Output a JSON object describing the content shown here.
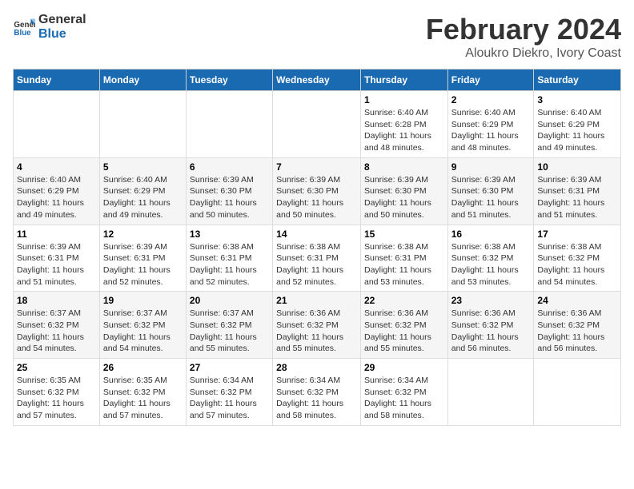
{
  "logo": {
    "text_general": "General",
    "text_blue": "Blue"
  },
  "header": {
    "title": "February 2024",
    "subtitle": "Aloukro Diekro, Ivory Coast"
  },
  "days_of_week": [
    "Sunday",
    "Monday",
    "Tuesday",
    "Wednesday",
    "Thursday",
    "Friday",
    "Saturday"
  ],
  "weeks": [
    [
      {
        "day": "",
        "detail": ""
      },
      {
        "day": "",
        "detail": ""
      },
      {
        "day": "",
        "detail": ""
      },
      {
        "day": "",
        "detail": ""
      },
      {
        "day": "1",
        "detail": "Sunrise: 6:40 AM\nSunset: 6:28 PM\nDaylight: 11 hours\nand 48 minutes."
      },
      {
        "day": "2",
        "detail": "Sunrise: 6:40 AM\nSunset: 6:29 PM\nDaylight: 11 hours\nand 48 minutes."
      },
      {
        "day": "3",
        "detail": "Sunrise: 6:40 AM\nSunset: 6:29 PM\nDaylight: 11 hours\nand 49 minutes."
      }
    ],
    [
      {
        "day": "4",
        "detail": "Sunrise: 6:40 AM\nSunset: 6:29 PM\nDaylight: 11 hours\nand 49 minutes."
      },
      {
        "day": "5",
        "detail": "Sunrise: 6:40 AM\nSunset: 6:29 PM\nDaylight: 11 hours\nand 49 minutes."
      },
      {
        "day": "6",
        "detail": "Sunrise: 6:39 AM\nSunset: 6:30 PM\nDaylight: 11 hours\nand 50 minutes."
      },
      {
        "day": "7",
        "detail": "Sunrise: 6:39 AM\nSunset: 6:30 PM\nDaylight: 11 hours\nand 50 minutes."
      },
      {
        "day": "8",
        "detail": "Sunrise: 6:39 AM\nSunset: 6:30 PM\nDaylight: 11 hours\nand 50 minutes."
      },
      {
        "day": "9",
        "detail": "Sunrise: 6:39 AM\nSunset: 6:30 PM\nDaylight: 11 hours\nand 51 minutes."
      },
      {
        "day": "10",
        "detail": "Sunrise: 6:39 AM\nSunset: 6:31 PM\nDaylight: 11 hours\nand 51 minutes."
      }
    ],
    [
      {
        "day": "11",
        "detail": "Sunrise: 6:39 AM\nSunset: 6:31 PM\nDaylight: 11 hours\nand 51 minutes."
      },
      {
        "day": "12",
        "detail": "Sunrise: 6:39 AM\nSunset: 6:31 PM\nDaylight: 11 hours\nand 52 minutes."
      },
      {
        "day": "13",
        "detail": "Sunrise: 6:38 AM\nSunset: 6:31 PM\nDaylight: 11 hours\nand 52 minutes."
      },
      {
        "day": "14",
        "detail": "Sunrise: 6:38 AM\nSunset: 6:31 PM\nDaylight: 11 hours\nand 52 minutes."
      },
      {
        "day": "15",
        "detail": "Sunrise: 6:38 AM\nSunset: 6:31 PM\nDaylight: 11 hours\nand 53 minutes."
      },
      {
        "day": "16",
        "detail": "Sunrise: 6:38 AM\nSunset: 6:32 PM\nDaylight: 11 hours\nand 53 minutes."
      },
      {
        "day": "17",
        "detail": "Sunrise: 6:38 AM\nSunset: 6:32 PM\nDaylight: 11 hours\nand 54 minutes."
      }
    ],
    [
      {
        "day": "18",
        "detail": "Sunrise: 6:37 AM\nSunset: 6:32 PM\nDaylight: 11 hours\nand 54 minutes."
      },
      {
        "day": "19",
        "detail": "Sunrise: 6:37 AM\nSunset: 6:32 PM\nDaylight: 11 hours\nand 54 minutes."
      },
      {
        "day": "20",
        "detail": "Sunrise: 6:37 AM\nSunset: 6:32 PM\nDaylight: 11 hours\nand 55 minutes."
      },
      {
        "day": "21",
        "detail": "Sunrise: 6:36 AM\nSunset: 6:32 PM\nDaylight: 11 hours\nand 55 minutes."
      },
      {
        "day": "22",
        "detail": "Sunrise: 6:36 AM\nSunset: 6:32 PM\nDaylight: 11 hours\nand 55 minutes."
      },
      {
        "day": "23",
        "detail": "Sunrise: 6:36 AM\nSunset: 6:32 PM\nDaylight: 11 hours\nand 56 minutes."
      },
      {
        "day": "24",
        "detail": "Sunrise: 6:36 AM\nSunset: 6:32 PM\nDaylight: 11 hours\nand 56 minutes."
      }
    ],
    [
      {
        "day": "25",
        "detail": "Sunrise: 6:35 AM\nSunset: 6:32 PM\nDaylight: 11 hours\nand 57 minutes."
      },
      {
        "day": "26",
        "detail": "Sunrise: 6:35 AM\nSunset: 6:32 PM\nDaylight: 11 hours\nand 57 minutes."
      },
      {
        "day": "27",
        "detail": "Sunrise: 6:34 AM\nSunset: 6:32 PM\nDaylight: 11 hours\nand 57 minutes."
      },
      {
        "day": "28",
        "detail": "Sunrise: 6:34 AM\nSunset: 6:32 PM\nDaylight: 11 hours\nand 58 minutes."
      },
      {
        "day": "29",
        "detail": "Sunrise: 6:34 AM\nSunset: 6:32 PM\nDaylight: 11 hours\nand 58 minutes."
      },
      {
        "day": "",
        "detail": ""
      },
      {
        "day": "",
        "detail": ""
      }
    ]
  ]
}
